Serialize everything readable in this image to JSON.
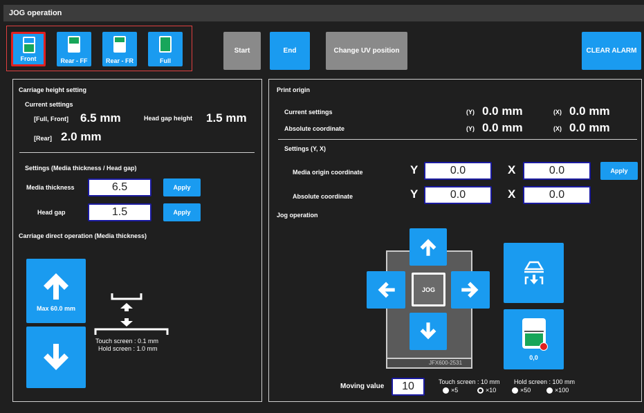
{
  "window": {
    "title": "JOG operation"
  },
  "modes": [
    {
      "label": "Front",
      "selected": true
    },
    {
      "label": "Rear - FF",
      "selected": false
    },
    {
      "label": "Rear - FR",
      "selected": false
    },
    {
      "label": "Full",
      "selected": false
    }
  ],
  "toolbar": {
    "start": "Start",
    "end": "End",
    "change_uv": "Change UV position",
    "clear_alarm": "CLEAR ALARM"
  },
  "carriage": {
    "title": "Carriage height setting",
    "current_settings": "Current settings",
    "full_front_label": "[Full, Front]",
    "full_front_value": "6.5 mm",
    "head_gap_height_label": "Head gap height",
    "head_gap_height_value": "1.5 mm",
    "rear_label": "[Rear]",
    "rear_value": "2.0 mm",
    "settings_title": "Settings (Media thickness / Head gap)",
    "media_thickness_label": "Media thickness",
    "media_thickness_value": "6.5",
    "head_gap_label": "Head gap",
    "head_gap_value": "1.5",
    "apply": "Apply",
    "direct_title": "Carriage direct operation (Media thickness)",
    "max_label": "Max 60.0 mm",
    "touch_note": "Touch screen : 0.1 mm",
    "hold_note": "Hold screen : 1.0 mm"
  },
  "origin": {
    "title": "Print origin",
    "current_settings": "Current settings",
    "absolute_coordinate": "Absolute coordinate",
    "y_tag": "(Y)",
    "x_tag": "(X)",
    "cur_y": "0.0 mm",
    "cur_x": "0.0 mm",
    "abs_y": "0.0 mm",
    "abs_x": "0.0 mm",
    "settings_title": "Settings (Y, X)",
    "media_origin_label": "Media origin coordinate",
    "absolute_label": "Absolute coordinate",
    "Y": "Y",
    "X": "X",
    "media_y": "0.0",
    "media_x": "0.0",
    "abs_set_y": "0.0",
    "abs_set_x": "0.0",
    "apply": "Apply"
  },
  "jog": {
    "title": "Jog operation",
    "center": "JOG",
    "machine": "JFX600-2531",
    "zero_label": "0,0",
    "moving_value_label": "Moving value",
    "moving_value": "10",
    "touch_note": "Touch screen : 10 mm",
    "hold_note": "Hold screen : 100 mm",
    "multipliers": [
      {
        "label": "×5",
        "selected": false
      },
      {
        "label": "×10",
        "selected": true
      },
      {
        "label": "×50",
        "selected": false
      },
      {
        "label": "×100",
        "selected": false
      }
    ]
  }
}
